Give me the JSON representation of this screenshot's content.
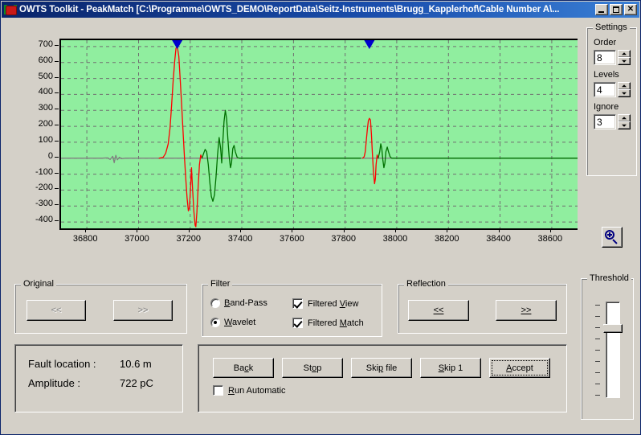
{
  "window": {
    "title": "OWTS Toolkit - PeakMatch  [C:\\Programme\\OWTS_DEMO\\ReportData\\Seitz-Instruments\\Brugg_Kapplerhof\\Cable Number A\\...",
    "icon": "owts-app-icon",
    "minimize_label": "",
    "maximize_label": "",
    "close_label": "✕"
  },
  "chart_data": {
    "type": "line",
    "title": "",
    "xlabel": "",
    "ylabel": "",
    "xlim": [
      36700,
      38700
    ],
    "ylim": [
      -440,
      740
    ],
    "xticks": [
      36800,
      37000,
      37200,
      37400,
      37600,
      37800,
      38000,
      38200,
      38400,
      38600
    ],
    "yticks": [
      -400,
      -300,
      -200,
      -100,
      0,
      100,
      200,
      300,
      400,
      500,
      600,
      700
    ],
    "grid": true,
    "legend": "none",
    "plot_bgcolor": "#90ee9f",
    "series": [
      {
        "name": "unfiltered-signal",
        "color": "#808080",
        "points": [
          [
            36700,
            0
          ],
          [
            36860,
            0
          ],
          [
            36880,
            2
          ],
          [
            36890,
            -8
          ],
          [
            36900,
            12
          ],
          [
            36906,
            -28
          ],
          [
            36912,
            18
          ],
          [
            36918,
            -10
          ],
          [
            36926,
            6
          ],
          [
            36934,
            -3
          ],
          [
            36950,
            0
          ],
          [
            37300,
            0
          ],
          [
            38700,
            0
          ]
        ]
      },
      {
        "name": "matched-peak-1",
        "color": "#ff0000",
        "points": [
          [
            37080,
            0
          ],
          [
            37095,
            5
          ],
          [
            37105,
            30
          ],
          [
            37115,
            90
          ],
          [
            37122,
            190
          ],
          [
            37128,
            330
          ],
          [
            37134,
            480
          ],
          [
            37140,
            610
          ],
          [
            37145,
            690
          ],
          [
            37150,
            700
          ],
          [
            37156,
            640
          ],
          [
            37162,
            480
          ],
          [
            37168,
            300
          ],
          [
            37174,
            120
          ],
          [
            37178,
            0
          ],
          [
            37183,
            -130
          ],
          [
            37188,
            -250
          ],
          [
            37193,
            -330
          ],
          [
            37197,
            -310
          ],
          [
            37201,
            -200
          ],
          [
            37205,
            -60
          ],
          [
            37209,
            -180
          ],
          [
            37214,
            -330
          ],
          [
            37219,
            -420
          ],
          [
            37222,
            -430
          ],
          [
            37226,
            -340
          ],
          [
            37231,
            -180
          ],
          [
            37236,
            -40
          ],
          [
            37241,
            20
          ],
          [
            37246,
            0
          ]
        ]
      },
      {
        "name": "filtered-signal",
        "color": "#007000",
        "points": [
          [
            37246,
            0
          ],
          [
            37252,
            30
          ],
          [
            37258,
            55
          ],
          [
            37264,
            40
          ],
          [
            37270,
            -40
          ],
          [
            37276,
            -150
          ],
          [
            37282,
            -240
          ],
          [
            37288,
            -270
          ],
          [
            37294,
            -230
          ],
          [
            37300,
            -120
          ],
          [
            37306,
            20
          ],
          [
            37312,
            130
          ],
          [
            37318,
            60
          ],
          [
            37322,
            -30
          ],
          [
            37326,
            95
          ],
          [
            37331,
            230
          ],
          [
            37336,
            300
          ],
          [
            37341,
            250
          ],
          [
            37346,
            120
          ],
          [
            37351,
            10
          ],
          [
            37356,
            -60
          ],
          [
            37360,
            -30
          ],
          [
            37365,
            60
          ],
          [
            37370,
            80
          ],
          [
            37375,
            40
          ],
          [
            37382,
            5
          ],
          [
            37390,
            0
          ],
          [
            37800,
            0
          ],
          [
            37860,
            0
          ]
        ]
      },
      {
        "name": "matched-peak-2",
        "color": "#ff0000",
        "points": [
          [
            37868,
            0
          ],
          [
            37874,
            10
          ],
          [
            37878,
            40
          ],
          [
            37882,
            110
          ],
          [
            37886,
            180
          ],
          [
            37890,
            235
          ],
          [
            37894,
            250
          ],
          [
            37898,
            240
          ],
          [
            37902,
            150
          ],
          [
            37906,
            20
          ],
          [
            37910,
            -90
          ],
          [
            37914,
            -160
          ],
          [
            37917,
            -130
          ],
          [
            37920,
            -40
          ],
          [
            37924,
            20
          ],
          [
            37928,
            0
          ]
        ]
      },
      {
        "name": "filtered-signal-2",
        "color": "#007000",
        "points": [
          [
            37928,
            0
          ],
          [
            37934,
            40
          ],
          [
            37938,
            90
          ],
          [
            37942,
            60
          ],
          [
            37946,
            -10
          ],
          [
            37950,
            -60
          ],
          [
            37954,
            -30
          ],
          [
            37958,
            40
          ],
          [
            37963,
            70
          ],
          [
            37968,
            40
          ],
          [
            37974,
            10
          ],
          [
            37980,
            0
          ],
          [
            38700,
            0
          ]
        ]
      }
    ],
    "markers": [
      {
        "name": "peak-marker-1",
        "x": 37150,
        "y": 700,
        "color": "#0000cc",
        "shape": "triangle-down"
      },
      {
        "name": "peak-marker-2",
        "x": 37894,
        "y": 250,
        "color": "#0000cc",
        "shape": "triangle-down"
      }
    ]
  },
  "settings": {
    "group_label": "Settings",
    "order": {
      "label": "Order",
      "value": "8"
    },
    "levels": {
      "label": "Levels",
      "value": "4"
    },
    "ignore": {
      "label": "Ignore",
      "value": "3"
    }
  },
  "zoom_button": {
    "icon": "magnifier-plus-icon"
  },
  "original": {
    "group_label": "Original",
    "prev_label": "<<",
    "next_label": ">>",
    "enabled": false
  },
  "filter": {
    "group_label": "Filter",
    "bandpass": {
      "label": "Band-Pass",
      "accel": "B",
      "selected": false
    },
    "wavelet": {
      "label": "Wavelet",
      "accel": "W",
      "selected": true
    },
    "filtered_view": {
      "label": "Filtered View",
      "accel": "V",
      "checked": true
    },
    "filtered_match": {
      "label": "Filtered Match",
      "accel": "M",
      "checked": true
    }
  },
  "reflection": {
    "group_label": "Reflection",
    "prev_label": "<<",
    "next_label": ">>",
    "enabled": true
  },
  "threshold": {
    "group_label": "Threshold",
    "tick_count": 9,
    "thumb_position": 3
  },
  "info": {
    "fault_location_label": "Fault location :",
    "fault_location_value": "10.6 m",
    "amplitude_label": "Amplitude :",
    "amplitude_value": "722 pC"
  },
  "actions": {
    "back": {
      "label": "Back",
      "accel": "c"
    },
    "stop": {
      "label": "Stop",
      "accel": "o"
    },
    "skip_file": {
      "label": "Skip file",
      "accel": "p"
    },
    "skip_1": {
      "label": "Skip 1",
      "accel": "S"
    },
    "accept": {
      "label": "Accept",
      "accel": "A",
      "focused": true
    },
    "run_automatic": {
      "label": "Run Automatic",
      "accel": "R",
      "checked": false
    }
  }
}
